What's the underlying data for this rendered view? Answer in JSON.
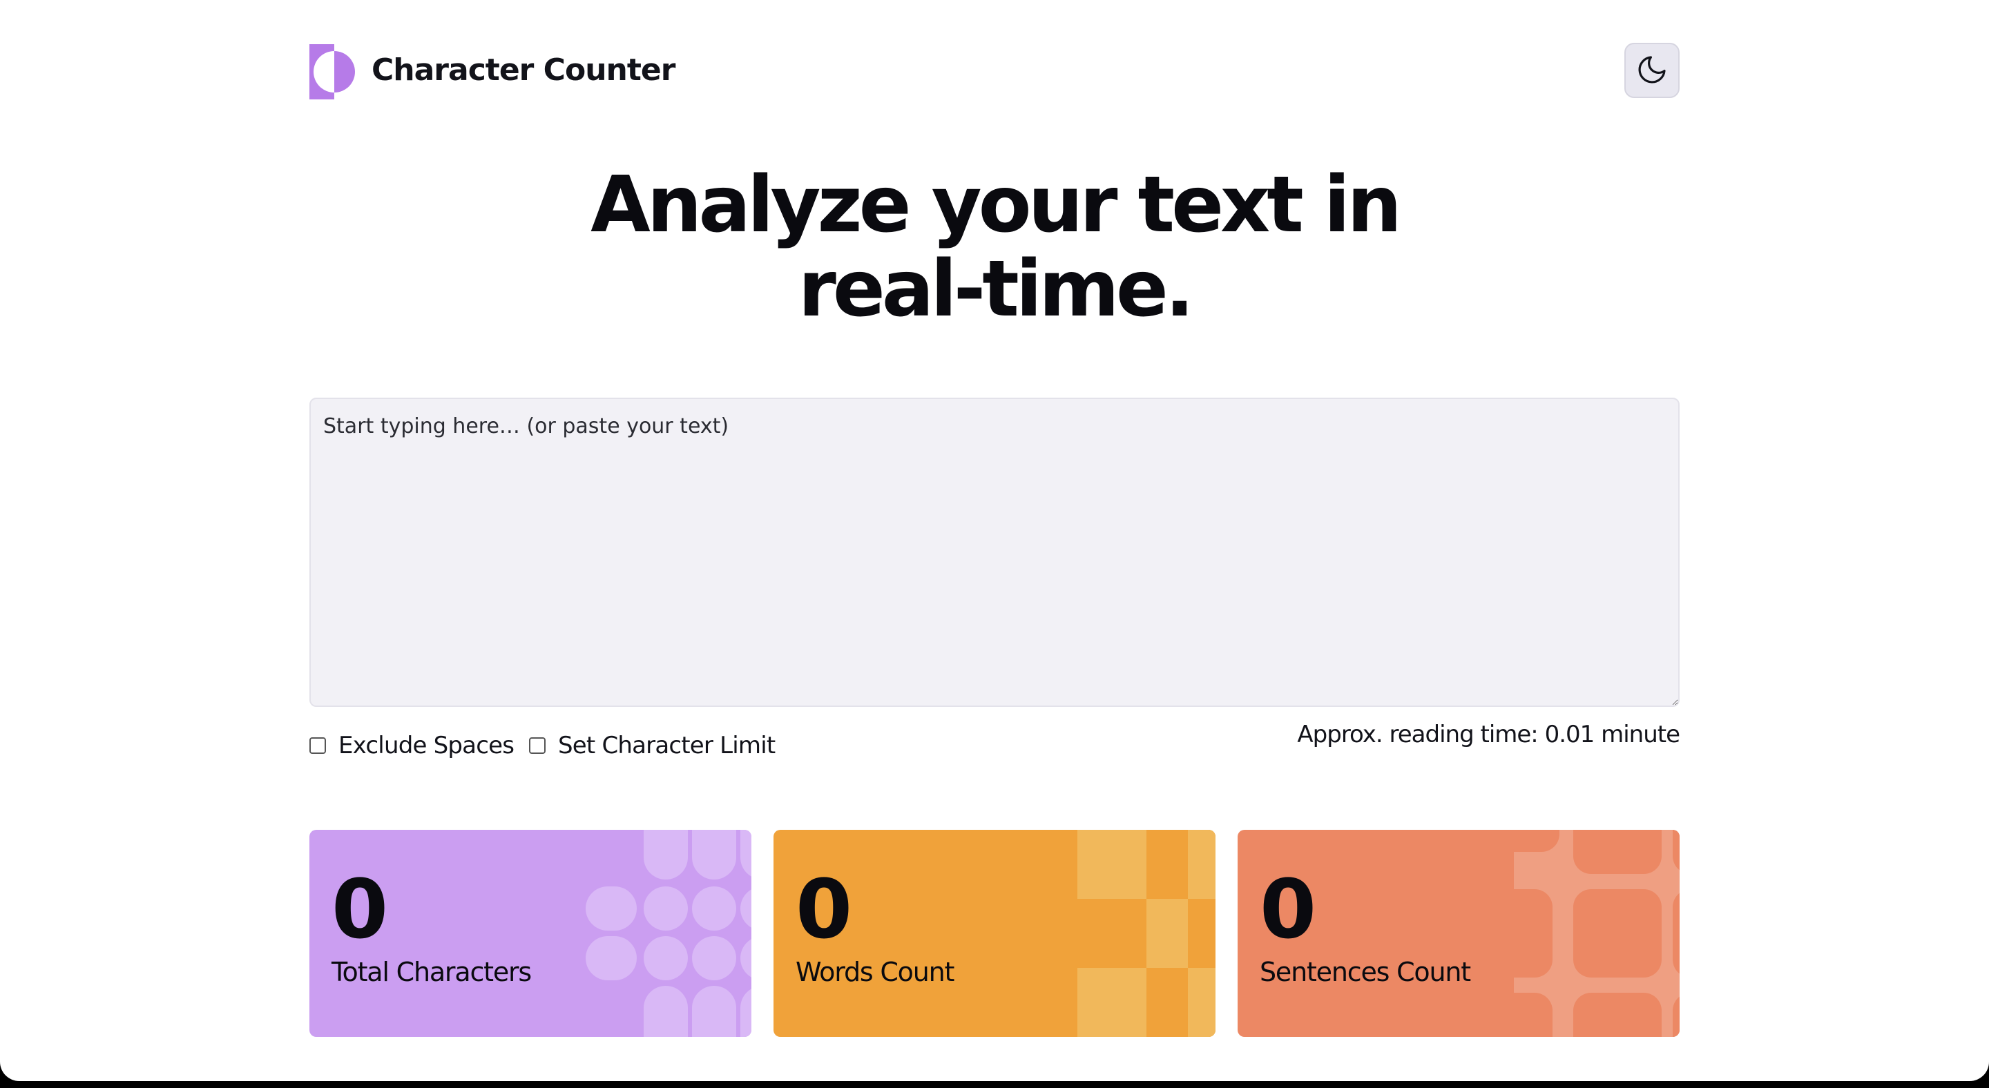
{
  "app": {
    "title": "Character Counter",
    "theme_toggle_icon": "moon-icon",
    "logo_icon": "half-circle-logo-icon"
  },
  "hero": {
    "line1": "Analyze your text in",
    "line2": "real-time."
  },
  "editor": {
    "placeholder": "Start typing here… (or paste your text)",
    "value": ""
  },
  "options": {
    "exclude_spaces": {
      "label": "Exclude Spaces",
      "checked": false
    },
    "char_limit": {
      "label": "Set Character Limit",
      "checked": false
    },
    "reading_time": "Approx. reading time: 0.01 minute"
  },
  "stats": [
    {
      "value": "0",
      "label": "Total Characters",
      "color": "#cb9ef1"
    },
    {
      "value": "0",
      "label": "Words Count",
      "color": "#f0a23a"
    },
    {
      "value": "0",
      "label": "Sentences Count",
      "color": "#ec8864"
    }
  ],
  "colors": {
    "accent_purple": "#b67be8",
    "background": "#ffffff",
    "input_bg": "#f2f1f6"
  }
}
